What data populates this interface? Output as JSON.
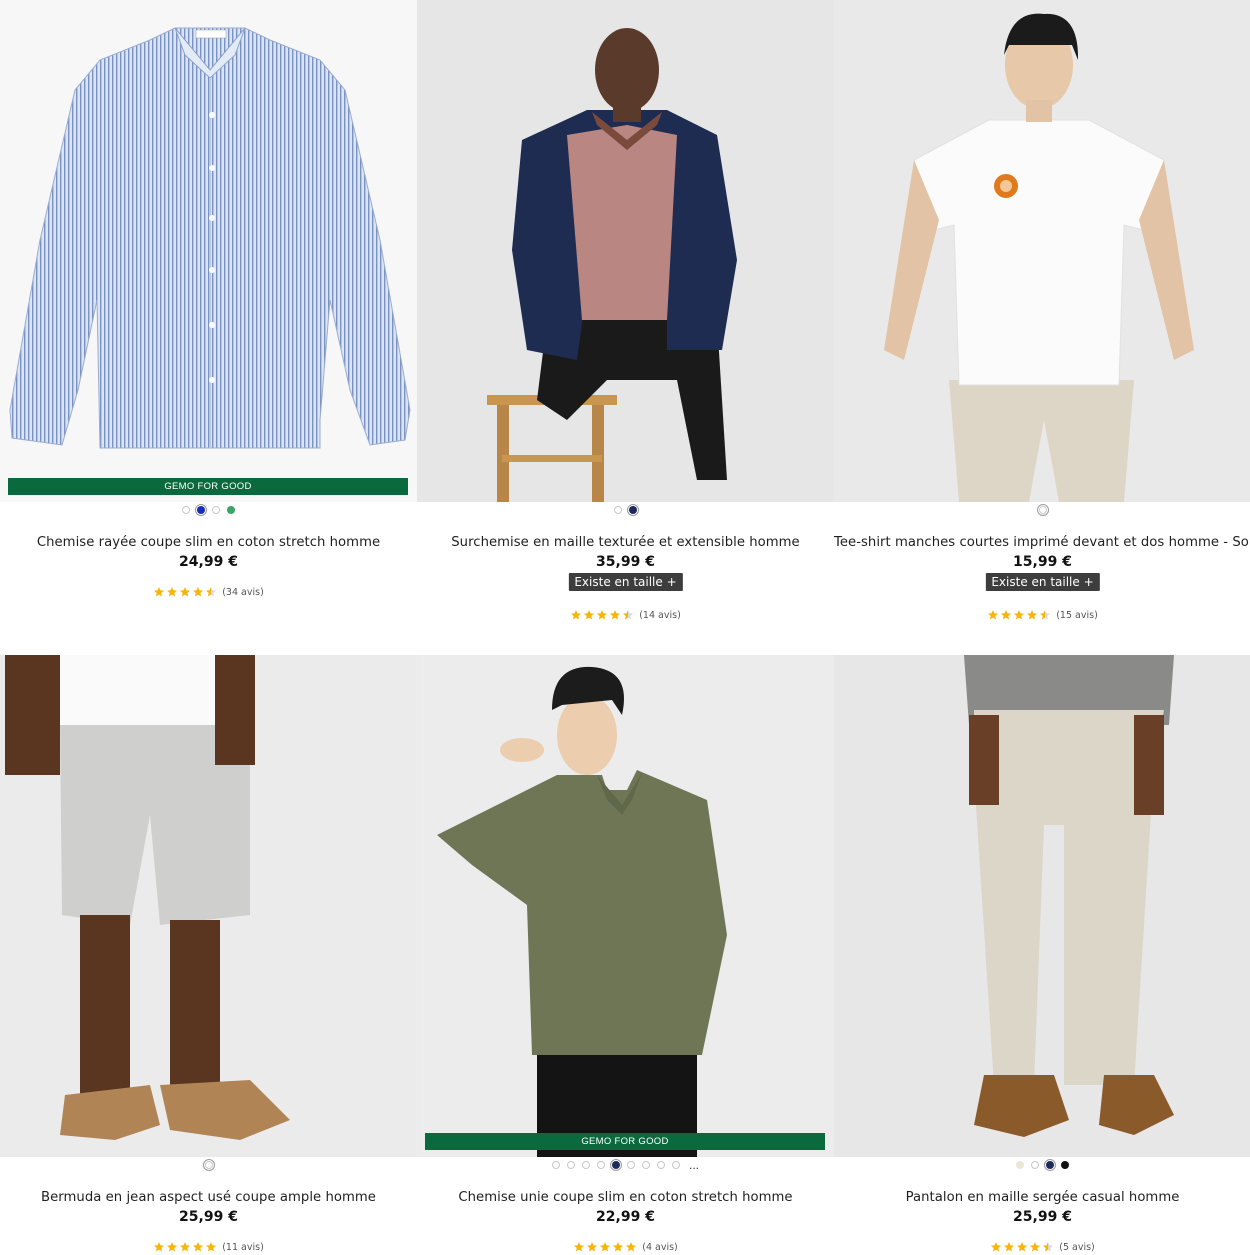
{
  "colors": {
    "badge_green": "#0b6a3d",
    "star_gold": "#f5b50a",
    "size_button_bg": "#3d3d3d"
  },
  "products": [
    {
      "name": "Chemise rayée coupe slim en coton stretch homme",
      "price": "24,99 €",
      "badge": "GEMO FOR GOOD",
      "swatches": [
        "#ffffff",
        "#1a2db8",
        "#ffffff",
        "#3aa566"
      ],
      "selected_swatch": 1,
      "rating": 4.5,
      "reviews": "(34 avis)",
      "size_button": ""
    },
    {
      "name": "Surchemise en maille texturée et extensible homme",
      "price": "35,99 €",
      "badge": "",
      "swatches": [
        "#ffffff",
        "#1d2a5c"
      ],
      "selected_swatch": 1,
      "rating": 4.5,
      "reviews": "(14 avis)",
      "size_button": "Existe en taille +"
    },
    {
      "name": "Tee-shirt manches courtes imprimé devant et dos homme - South Park",
      "price": "15,99 €",
      "badge": "",
      "swatches": [
        "#ffffff"
      ],
      "selected_swatch": 0,
      "rating": 4.5,
      "reviews": "(15 avis)",
      "size_button": "Existe en taille +"
    },
    {
      "name": "Bermuda en jean aspect usé coupe ample homme",
      "price": "25,99 €",
      "badge": "",
      "swatches": [
        "#ffffff"
      ],
      "selected_swatch": 0,
      "rating": 5,
      "reviews": "(11 avis)",
      "size_button": ""
    },
    {
      "name": "Chemise unie coupe slim en coton stretch homme",
      "price": "22,99 €",
      "badge": "GEMO FOR GOOD",
      "swatches": [
        "#ffffff",
        "#ffffff",
        "#ffffff",
        "#ffffff",
        "#1d2a5c",
        "#ffffff",
        "#ffffff",
        "#ffffff",
        "#ffffff"
      ],
      "selected_swatch": 4,
      "more": "...",
      "rating": 5,
      "reviews": "(4 avis)",
      "size_button": ""
    },
    {
      "name": "Pantalon en maille sergée casual homme",
      "price": "25,99 €",
      "badge": "",
      "swatches": [
        "#ece6d6",
        "#ffffff",
        "#1d2a5c",
        "#111111"
      ],
      "selected_swatch": 2,
      "rating": 4.5,
      "reviews": "(5 avis)",
      "size_button": ""
    }
  ],
  "images": [
    {
      "icon": "striped-shirt-image"
    },
    {
      "icon": "model-navy-overshirt-image"
    },
    {
      "icon": "model-white-tee-image"
    },
    {
      "icon": "model-denim-bermuda-image"
    },
    {
      "icon": "model-khaki-shirt-image"
    },
    {
      "icon": "model-beige-trousers-image"
    }
  ]
}
